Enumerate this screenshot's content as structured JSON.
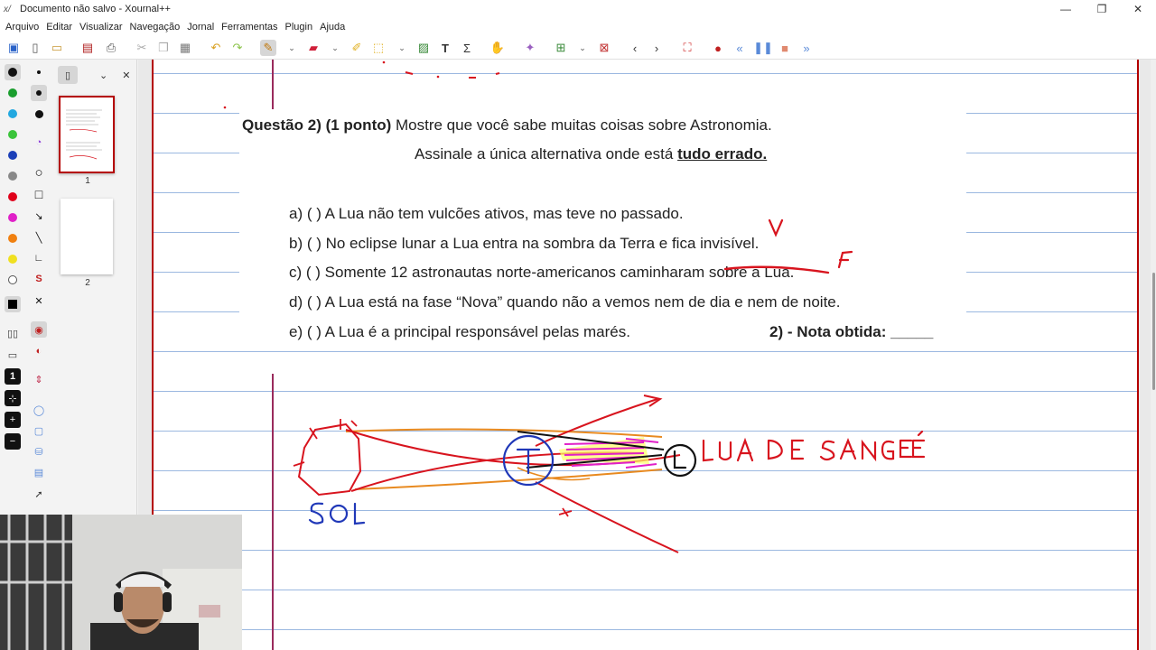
{
  "window": {
    "title": "Documento não salvo - Xournal++",
    "controls": {
      "minimize": "—",
      "maximize": "❐",
      "close": "✕"
    }
  },
  "menu": [
    "Arquivo",
    "Editar",
    "Visualizar",
    "Navegação",
    "Jornal",
    "Ferramentas",
    "Plugin",
    "Ajuda"
  ],
  "colors": {
    "palette": [
      "#111111",
      "#1a9e2e",
      "#22a8e0",
      "#3ac43a",
      "#1b3fb8",
      "#888888",
      "#e0001a",
      "#e020c8",
      "#f08010",
      "#f0e020",
      "#ffffff"
    ],
    "ink_red": "#d8141e",
    "ink_blue": "#2038b8",
    "ink_orange": "#e88a20",
    "page_margin": "#b40000",
    "rule": "#9bb8e0"
  },
  "sidebar": {
    "pages": [
      {
        "number": "1"
      },
      {
        "number": "2"
      }
    ]
  },
  "document": {
    "question_title_bold": "Questão 2) (1 ponto)",
    "question_title_rest": " Mostre que você sabe muitas coisas sobre Astronomia.",
    "question_subtitle_pre": "Assinale a única alternativa onde está ",
    "question_subtitle_bold": "tudo errado.",
    "options": [
      "a) (    ) A Lua não tem vulcões ativos, mas teve no passado.",
      "b) (    ) No eclipse lunar a Lua entra na sombra da Terra e fica invisível.",
      "c) (    ) Somente 12 astronautas norte-americanos caminharam sobre a Lua.",
      "d) (    ) A Lua está na fase “Nova” quando não a vemos nem de dia e nem de noite.",
      "e) (    ) A Lua é a principal responsável pelas marés."
    ],
    "nota": "2) - Nota obtida: _____"
  },
  "annotations": {
    "mark_a": "V",
    "mark_b": "F",
    "sun_label": "SOL",
    "earth_label": "T",
    "moon_label": "L",
    "moon_caption": "LUA DE SANGUE"
  }
}
